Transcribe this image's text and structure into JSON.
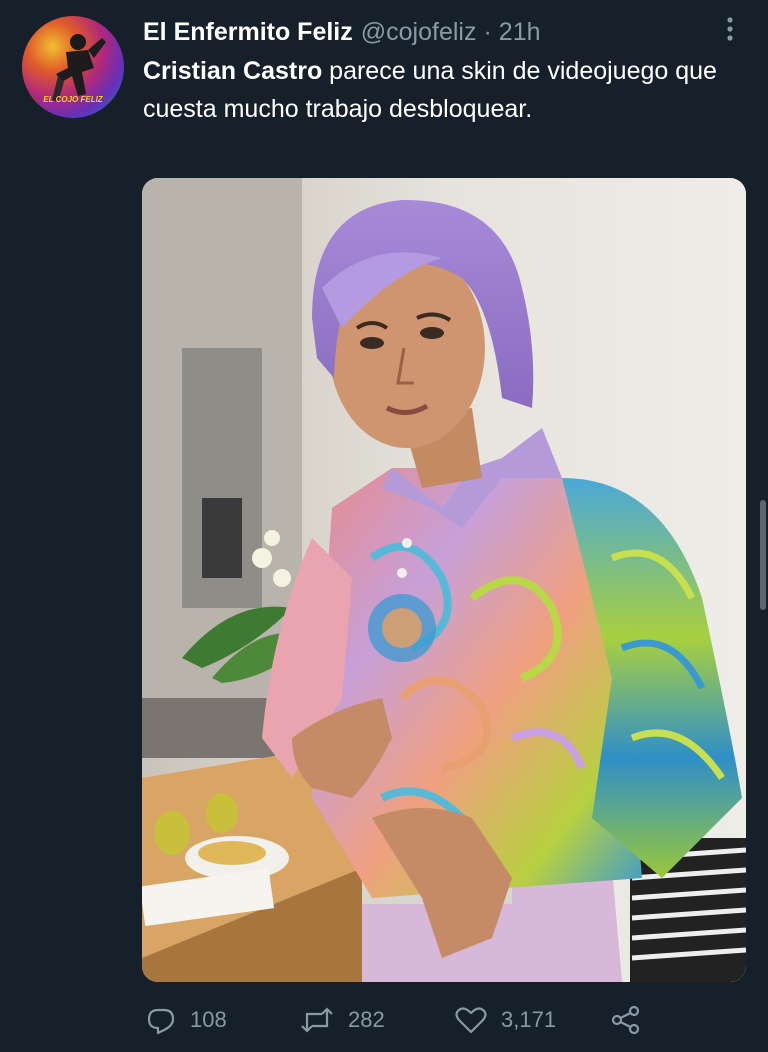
{
  "tweet": {
    "author_name": "El Enfermito Feliz",
    "author_handle": "@cojofeliz",
    "separator": "·",
    "time": "21h",
    "text_mention": "Cristian Castro",
    "text_rest": " parece una skin de videojuego que cuesta mucho trabajo desbloquear."
  },
  "avatar": {
    "logo_text": "EL COJO FELIZ"
  },
  "media": {
    "description_icon": "photo"
  },
  "actions": {
    "replies": "108",
    "retweets": "282",
    "likes": "3,171"
  },
  "colors": {
    "background": "#15202b",
    "text": "#ffffff",
    "secondary": "#8b98a5"
  }
}
